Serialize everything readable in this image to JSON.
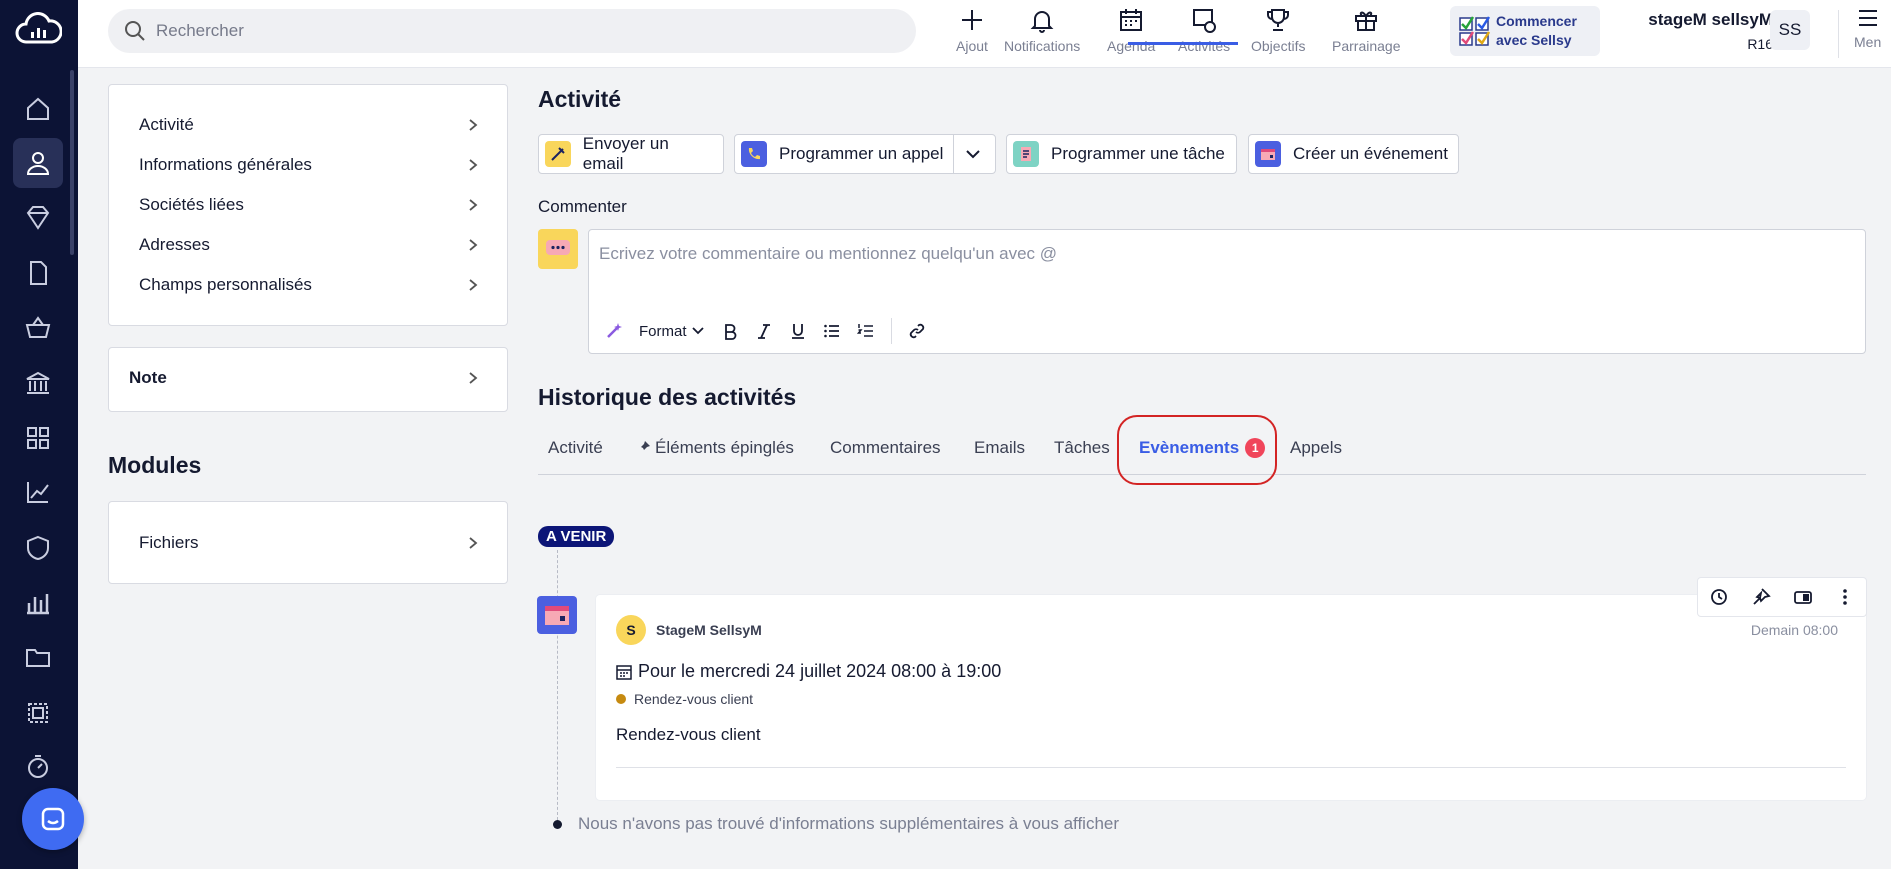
{
  "search": {
    "placeholder": "Rechercher"
  },
  "toolbar": {
    "items": [
      {
        "label": "Ajout",
        "icon": "plus-icon"
      },
      {
        "label": "Notifications",
        "icon": "bell-icon"
      },
      {
        "label": "Agenda",
        "icon": "calendar-icon"
      },
      {
        "label": "Activités",
        "icon": "activity-icon"
      },
      {
        "label": "Objectifs",
        "icon": "trophy-icon"
      },
      {
        "label": "Parrainage",
        "icon": "gift-icon"
      }
    ],
    "start_card": {
      "line1": "Commencer",
      "line2": "avec Sellsy"
    },
    "user": {
      "name": "stageM sellsyM",
      "sub": "R16",
      "initials": "SS"
    },
    "menu_label": "Men"
  },
  "left_panel": {
    "items": [
      "Activité",
      "Informations générales",
      "Sociétés liées",
      "Adresses",
      "Champs personnalisés"
    ],
    "note_label": "Note",
    "modules_title": "Modules",
    "files_label": "Fichiers"
  },
  "activity": {
    "title": "Activité",
    "actions": {
      "email": "Envoyer un email",
      "call": "Programmer un appel",
      "task": "Programmer une tâche",
      "event": "Créer un événement"
    },
    "comment_label": "Commenter",
    "comment_placeholder": "Ecrivez votre commentaire ou mentionnez quelqu'un avec @",
    "format_label": "Format"
  },
  "history": {
    "title": "Historique des activités",
    "tabs": [
      "Activité",
      "Éléments épinglés",
      "Commentaires",
      "Emails",
      "Tâches",
      "Evènements",
      "Appels"
    ],
    "active_tab": "Evènements",
    "events_badge": "1",
    "upcoming_label": "A VENIR",
    "event": {
      "avatar_letter": "S",
      "author": "StageM SellsyM",
      "time": "Demain 08:00",
      "date": "Pour le mercredi 24 juillet 2024 08:00 à 19:00",
      "tag": "Rendez-vous client",
      "title": "Rendez-vous client"
    },
    "end_text": "Nous n'avons pas trouvé d'informations supplémentaires à vous afficher"
  },
  "colors": {
    "accent": "#3a5de5",
    "nav_bg": "#0c1335",
    "badge": "#f0455a",
    "highlight": "#d32424"
  }
}
